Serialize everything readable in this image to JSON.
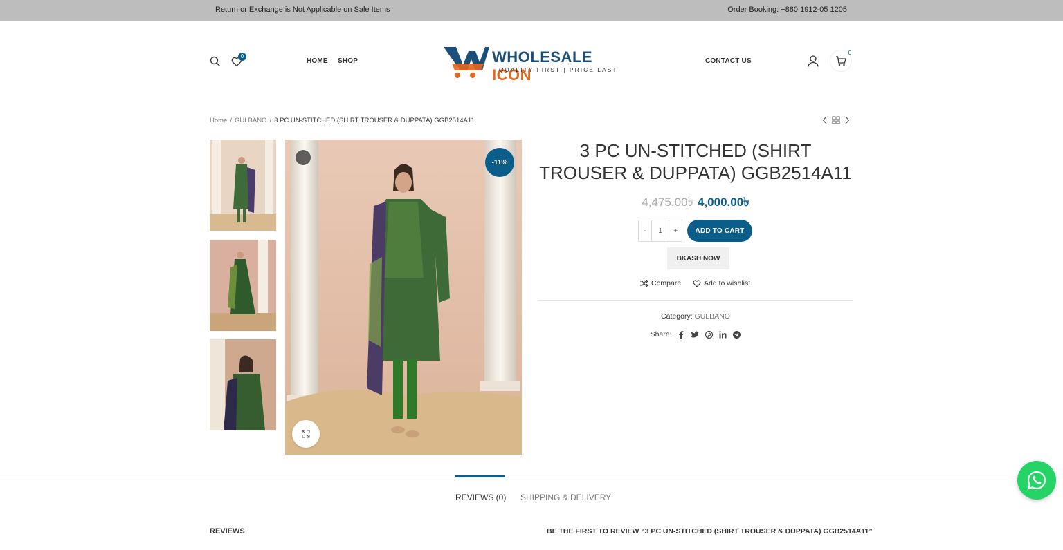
{
  "topbar": {
    "notice": "Return or Exchange is Not Applicable on Sale Items",
    "order_booking": "Order Booking: +880 1912-05 1205"
  },
  "header": {
    "wishlist_count": "0",
    "cart_count": "0",
    "nav": {
      "home": "HOME",
      "shop": "SHOP",
      "contact": "CONTACT US"
    },
    "logo": {
      "brand_part1": "WHOLESALE",
      "brand_part2": "ICON",
      "tagline": "QUALITY FIRST  |  PRICE LAST"
    }
  },
  "breadcrumb": {
    "home": "Home",
    "category": "GULBANO",
    "current": "3 PC UN-STITCHED (SHIRT TROUSER & DUPPATA) GGB2514A11"
  },
  "product": {
    "title": "3 PC UN-STITCHED (SHIRT TROUSER & DUPPATA) GGB2514A11",
    "old_price": "4,475.00৳",
    "new_price": "4,000.00৳",
    "sale_badge": "-11%",
    "qty_minus": "-",
    "qty_value": "1",
    "qty_plus": "+",
    "add_to_cart": "ADD TO CART",
    "bkash": "BKASH NOW",
    "compare": "Compare",
    "wishlist": "Add to wishlist",
    "category_label": "Category:",
    "category_value": "GULBANO",
    "share_label": "Share:"
  },
  "tabs": [
    {
      "label": "REVIEWS (0)",
      "active": true
    },
    {
      "label": "SHIPPING & DELIVERY",
      "active": false
    }
  ],
  "reviews": {
    "heading": "REVIEWS",
    "first_review": "BE THE FIRST TO REVIEW “3 PC UN-STITCHED (SHIRT TROUSER & DUPPATA) GGB2514A11”"
  },
  "colors": {
    "accent": "#0b5d8a",
    "brand_orange": "#e8651e",
    "topbar_bg": "#bdbdbd",
    "whatsapp": "#25d366"
  }
}
